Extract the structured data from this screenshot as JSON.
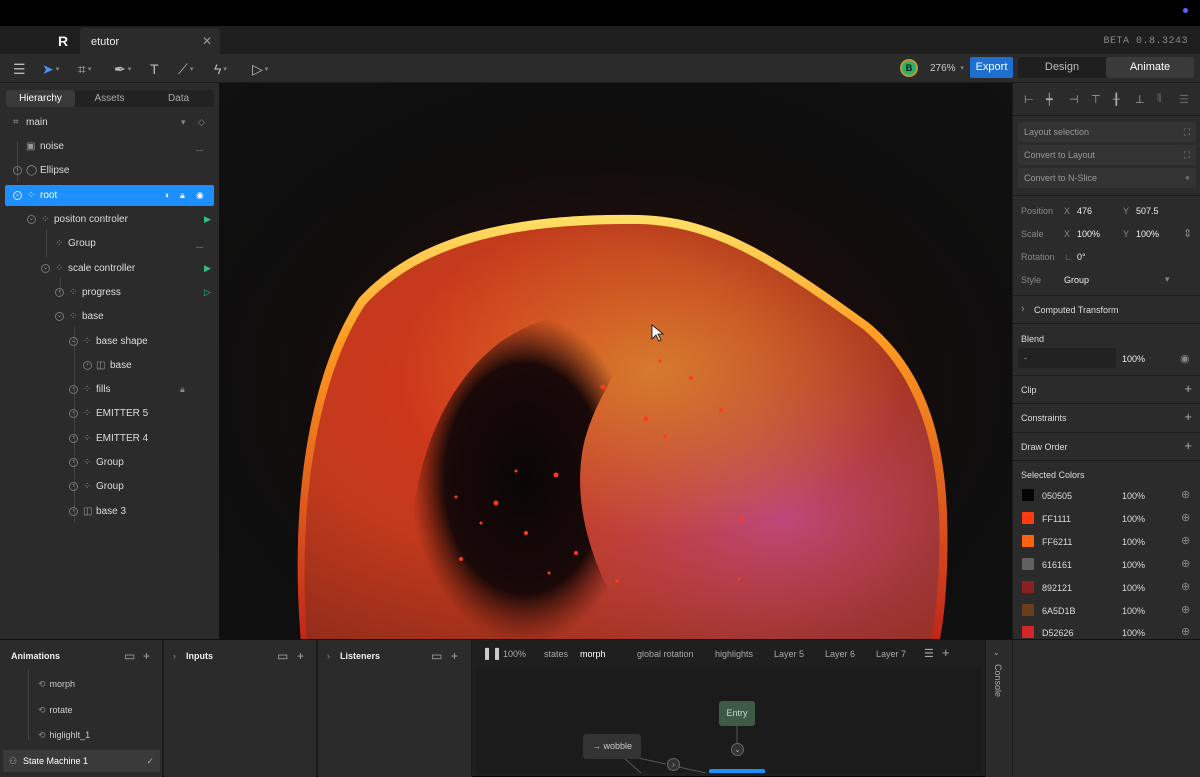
{
  "window": {
    "file_tab": "etutor",
    "version": "BETA 0.8.3243"
  },
  "toolbar": {
    "avatar_initial": "B",
    "zoom": "276%",
    "export_label": "Export",
    "mode_design": "Design",
    "mode_animate": "Animate"
  },
  "left_panel": {
    "tabs": [
      "Hierarchy",
      "Assets",
      "Data"
    ],
    "tree": [
      {
        "label": "main"
      },
      {
        "label": "noise"
      },
      {
        "label": "Ellipse"
      },
      {
        "label": "root"
      },
      {
        "label": "positon controler"
      },
      {
        "label": "Group"
      },
      {
        "label": "scale controller"
      },
      {
        "label": "progress"
      },
      {
        "label": "base"
      },
      {
        "label": "base shape"
      },
      {
        "label": "base"
      },
      {
        "label": "fills"
      },
      {
        "label": "EMITTER 5"
      },
      {
        "label": "EMITTER 4"
      },
      {
        "label": "Group"
      },
      {
        "label": "Group"
      },
      {
        "label": "base 3"
      }
    ]
  },
  "right_panel": {
    "layout_selection": "Layout selection",
    "convert_layout": "Convert to Layout",
    "convert_nslice": "Convert to N-Slice",
    "position_label": "Position",
    "pos_x_label": "X",
    "pos_x": "476",
    "pos_y_label": "Y",
    "pos_y": "507.5",
    "scale_label": "Scale",
    "scale_x": "100%",
    "scale_y": "100%",
    "rotation_label": "Rotation",
    "rotation": "0°",
    "style_label": "Style",
    "style": "Group",
    "computed_transform": "Computed Transform",
    "blend_label": "Blend",
    "blend_mode": "-",
    "blend_opacity": "100%",
    "clip": "Clip",
    "constraints": "Constraints",
    "draw_order": "Draw Order",
    "selected_colors_label": "Selected Colors",
    "colors": [
      {
        "hex": "050505",
        "pct": "100%",
        "swatch": "#050505"
      },
      {
        "hex": "FF1111",
        "pct": "100%",
        "swatch": "#ff3b11"
      },
      {
        "hex": "FF6211",
        "pct": "100%",
        "swatch": "#ff6211"
      },
      {
        "hex": "616161",
        "pct": "100%",
        "swatch": "#616161"
      },
      {
        "hex": "892121",
        "pct": "100%",
        "swatch": "#892121"
      },
      {
        "hex": "6A5D1B",
        "pct": "100%",
        "swatch": "#6a3d1b"
      },
      {
        "hex": "D52626",
        "pct": "100%",
        "swatch": "#d52626"
      }
    ]
  },
  "bottom": {
    "animations_title": "Animations",
    "animations": [
      "morph",
      "rotate",
      "higlighlt_1"
    ],
    "state_machine": "State Machine 1",
    "inputs_title": "Inputs",
    "listeners_title": "Listeners",
    "graph_zoom": "100%",
    "graph_tabs": [
      "states",
      "morph",
      "global rotation",
      "highlights",
      "Layer 5",
      "Layer 6",
      "Layer 7"
    ],
    "node_entry": "Entry",
    "node_wobble": "→ wobble",
    "console_label": "Console"
  }
}
